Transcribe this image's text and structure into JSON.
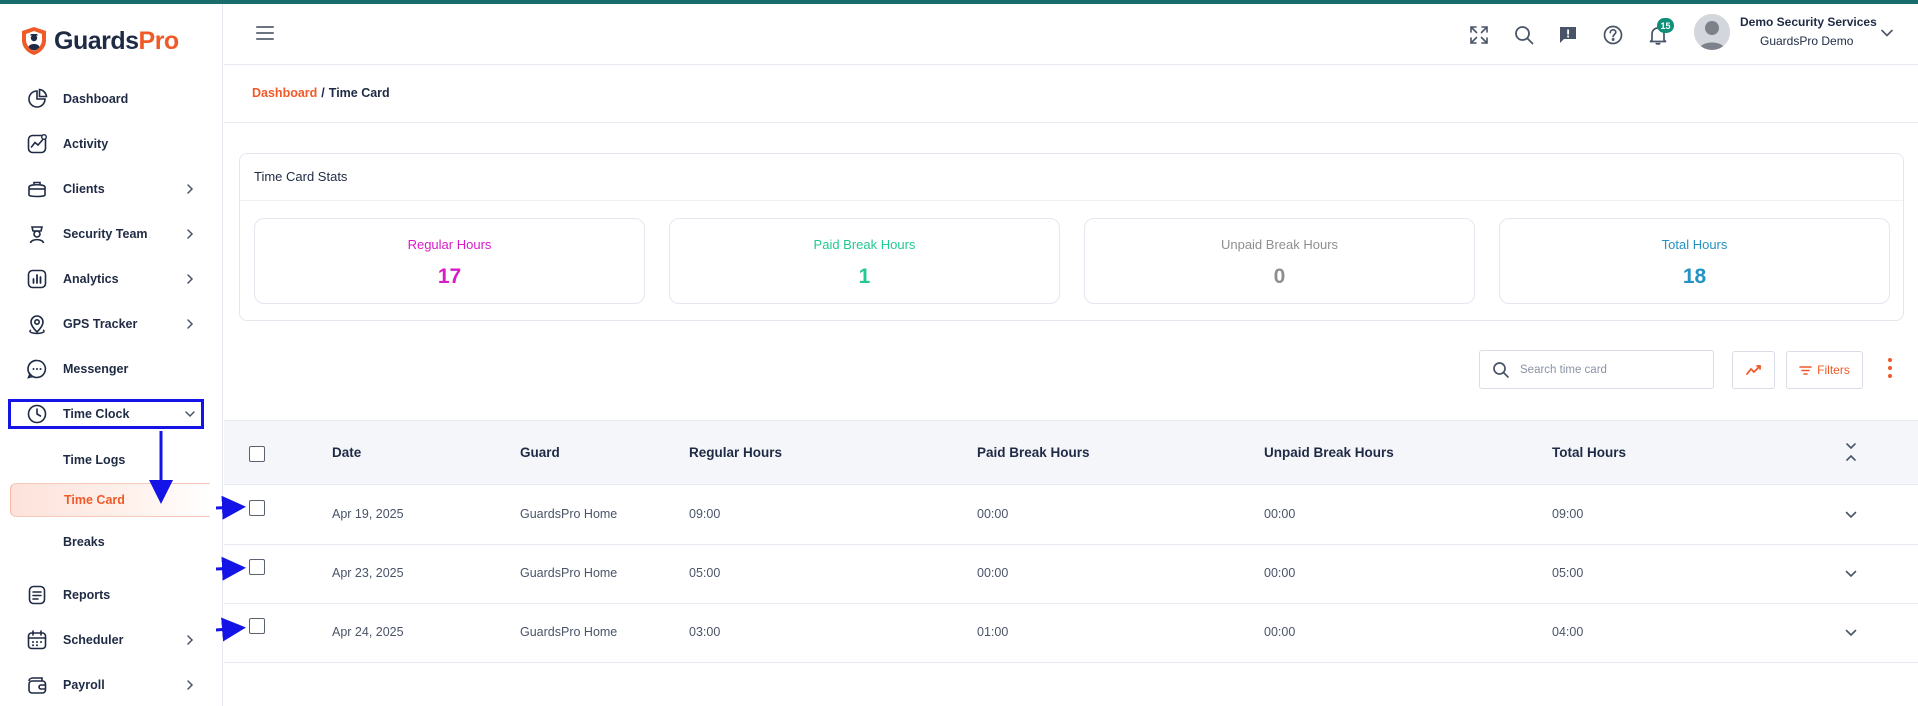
{
  "brand": {
    "name_part1": "Guards",
    "name_part2": "Pro"
  },
  "sidebar": {
    "items": [
      {
        "label": "Dashboard",
        "icon": "pie-chart-icon",
        "chevron": false
      },
      {
        "label": "Activity",
        "icon": "activity-icon",
        "chevron": false
      },
      {
        "label": "Clients",
        "icon": "briefcase-icon",
        "chevron": true
      },
      {
        "label": "Security Team",
        "icon": "guard-icon",
        "chevron": true
      },
      {
        "label": "Analytics",
        "icon": "analytics-icon",
        "chevron": true
      },
      {
        "label": "GPS Tracker",
        "icon": "location-pin-icon",
        "chevron": true
      },
      {
        "label": "Messenger",
        "icon": "chat-icon",
        "chevron": false
      },
      {
        "label": "Time Clock",
        "icon": "clock-icon",
        "chevron": true,
        "expanded": true
      },
      {
        "label": "Reports",
        "icon": "report-icon",
        "chevron": false
      },
      {
        "label": "Scheduler",
        "icon": "calendar-icon",
        "chevron": true
      },
      {
        "label": "Payroll",
        "icon": "wallet-icon",
        "chevron": true
      }
    ],
    "subitems": [
      {
        "label": "Time Logs"
      },
      {
        "label": "Time Card",
        "current": true
      },
      {
        "label": "Breaks"
      }
    ]
  },
  "header": {
    "icons": [
      "fullscreen-icon",
      "search-icon",
      "feedback-icon",
      "help-icon",
      "bell-icon"
    ],
    "notification_count": "15",
    "user_name": "Demo Security Services",
    "user_org": "GuardsPro Demo"
  },
  "breadcrumb": {
    "home": "Dashboard",
    "separator": "/",
    "current": "Time Card"
  },
  "stats": {
    "title": "Time Card Stats",
    "boxes": [
      {
        "label": "Regular Hours",
        "value": "17",
        "color": "#d81bc7"
      },
      {
        "label": "Paid Break Hours",
        "value": "1",
        "color": "#22c993"
      },
      {
        "label": "Unpaid Break Hours",
        "value": "0",
        "color": "#8f8f8f"
      },
      {
        "label": "Total Hours",
        "value": "18",
        "color": "#2492c4"
      }
    ]
  },
  "toolbar": {
    "search_placeholder": "Search time card",
    "filters_label": "Filters"
  },
  "table": {
    "columns": [
      "Date",
      "Guard",
      "Regular Hours",
      "Paid Break Hours",
      "Unpaid Break Hours",
      "Total Hours"
    ],
    "rows": [
      {
        "date": "Apr 19, 2025",
        "guard": "GuardsPro Home",
        "regular": "09:00",
        "paid_break": "00:00",
        "unpaid_break": "00:00",
        "total": "09:00"
      },
      {
        "date": "Apr 23, 2025",
        "guard": "GuardsPro Home",
        "regular": "05:00",
        "paid_break": "00:00",
        "unpaid_break": "00:00",
        "total": "05:00"
      },
      {
        "date": "Apr 24, 2025",
        "guard": "GuardsPro Home",
        "regular": "03:00",
        "paid_break": "01:00",
        "unpaid_break": "00:00",
        "total": "04:00"
      }
    ]
  },
  "colors": {
    "accent": "#f05a28",
    "navy": "#1f2a44",
    "annotation": "#1414e6",
    "badge": "#0f8f78"
  }
}
